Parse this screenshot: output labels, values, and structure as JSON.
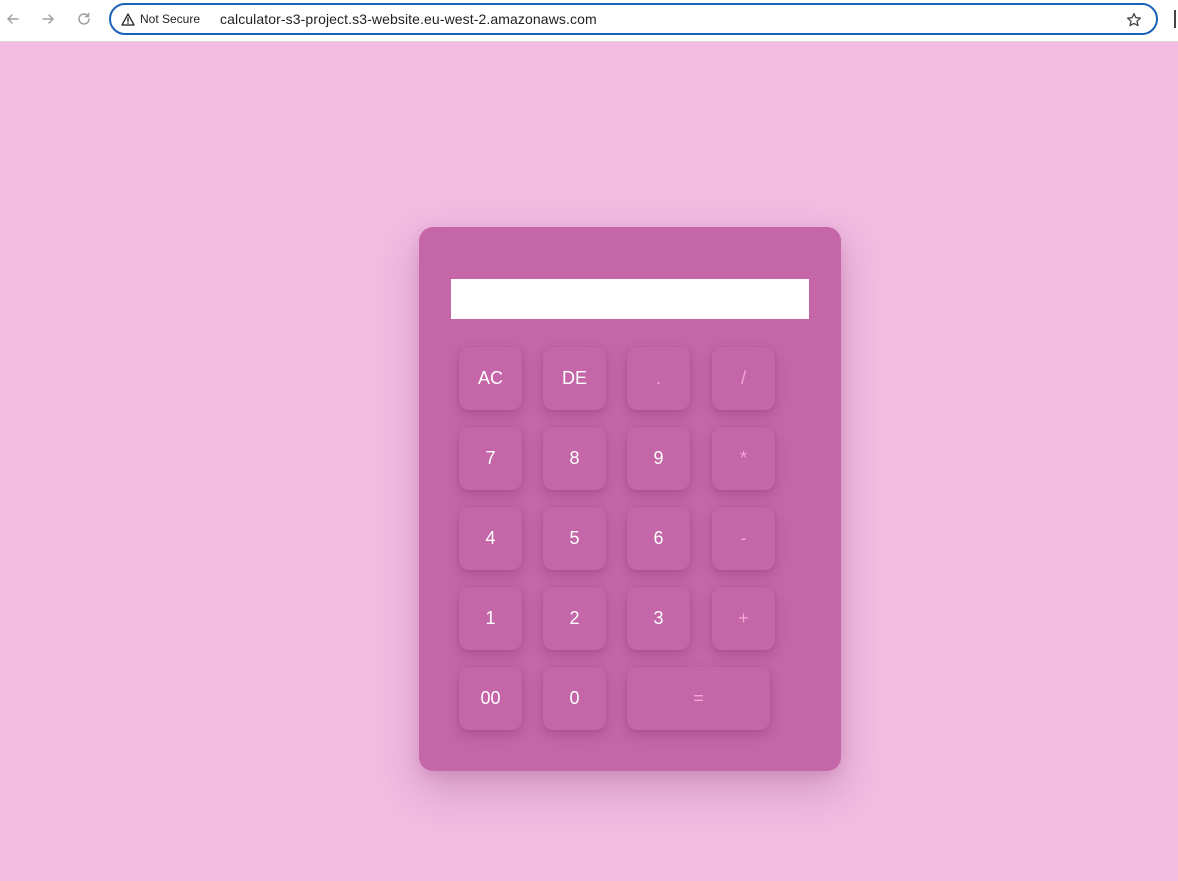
{
  "browser": {
    "security_label": "Not Secure",
    "url": "calculator-s3-project.s3-website.eu-west-2.amazonaws.com",
    "icons": {
      "back": "arrow-left-icon",
      "forward": "arrow-right-icon",
      "reload": "reload-icon",
      "warning": "warning-triangle-icon",
      "bookmark": "star-icon"
    }
  },
  "calculator": {
    "display_value": "",
    "rows": [
      [
        {
          "label": "AC",
          "type": "fn"
        },
        {
          "label": "DE",
          "type": "fn"
        },
        {
          "label": ".",
          "type": "op"
        },
        {
          "label": "/",
          "type": "op"
        }
      ],
      [
        {
          "label": "7",
          "type": "num"
        },
        {
          "label": "8",
          "type": "num"
        },
        {
          "label": "9",
          "type": "num"
        },
        {
          "label": "*",
          "type": "op"
        }
      ],
      [
        {
          "label": "4",
          "type": "num"
        },
        {
          "label": "5",
          "type": "num"
        },
        {
          "label": "6",
          "type": "num"
        },
        {
          "label": "-",
          "type": "op"
        }
      ],
      [
        {
          "label": "1",
          "type": "num"
        },
        {
          "label": "2",
          "type": "num"
        },
        {
          "label": "3",
          "type": "num"
        },
        {
          "label": "+",
          "type": "op"
        }
      ],
      [
        {
          "label": "00",
          "type": "num"
        },
        {
          "label": "0",
          "type": "num"
        },
        {
          "label": "=",
          "type": "op"
        }
      ]
    ]
  },
  "colors": {
    "page_background": "#f1bbe2",
    "calculator_body": "#c466a8",
    "operator_text": "#f7a6d8",
    "number_text": "#ffffff",
    "address_bar_border": "#1a62b8"
  }
}
